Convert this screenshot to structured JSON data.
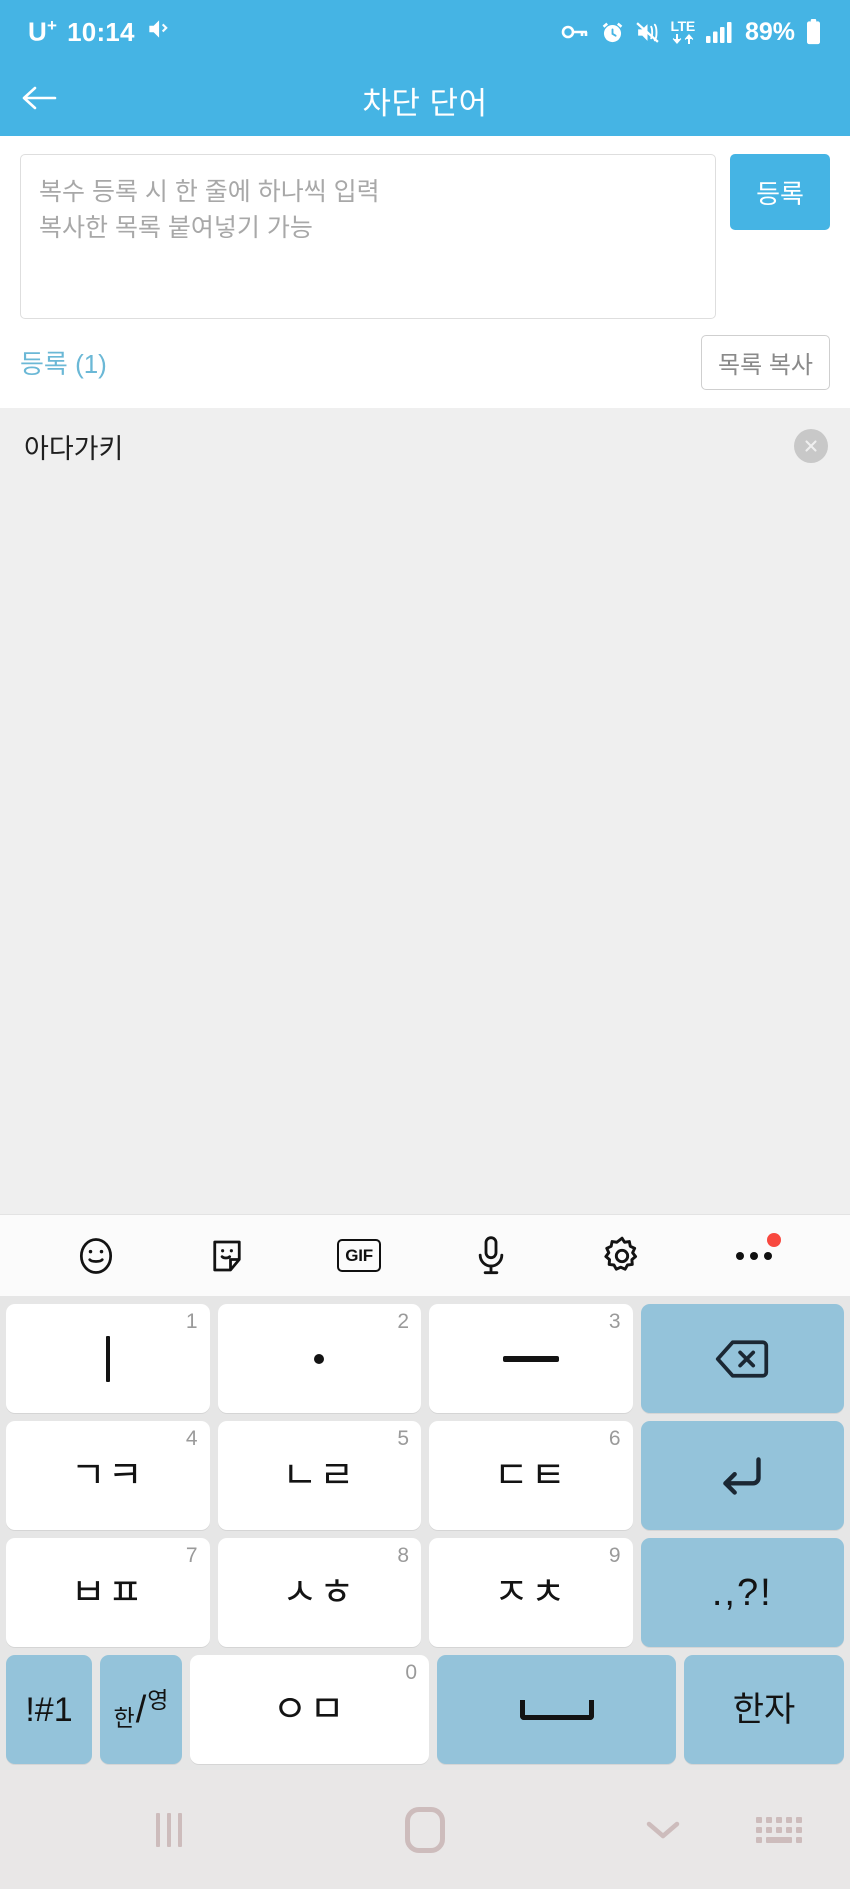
{
  "statusbar": {
    "carrier": "U",
    "carrier_sup": "+",
    "time": "10:14",
    "mute_icon": "mute-vibrate-icon",
    "vpn_key_icon": "vpn-key-icon",
    "alarm_icon": "alarm-icon",
    "sound_off_icon": "sound-off-icon",
    "network_type": "LTE",
    "signal_icon": "signal-bars-icon",
    "battery_percent": "89%",
    "battery_icon": "battery-icon"
  },
  "appbar": {
    "back_icon": "back-arrow-icon",
    "title": "차단 단어"
  },
  "compose": {
    "placeholder": "복수 등록 시 한 줄에 하나씩 입력\n복사한 목록 붙여넣기 가능",
    "value": "",
    "register_label": "등록"
  },
  "list_header": {
    "count_label": "등록 (1)",
    "copy_label": "목록 복사"
  },
  "list": {
    "items": [
      {
        "text": "아다가키",
        "delete_icon": "close-circle-icon"
      }
    ]
  },
  "keyboard_toolbar": {
    "items": [
      {
        "name": "emoji-icon",
        "label": "이모티콘"
      },
      {
        "name": "sticker-icon",
        "label": "스티커"
      },
      {
        "name": "gif-icon",
        "label": "GIF"
      },
      {
        "name": "microphone-icon",
        "label": "음성 입력"
      },
      {
        "name": "gear-icon",
        "label": "설정"
      },
      {
        "name": "more-options-icon",
        "label": "더보기"
      }
    ],
    "badge": true
  },
  "keyboard": {
    "rows": [
      [
        {
          "glyph": "ㅣ",
          "num": "1",
          "type": "char"
        },
        {
          "glyph": "·",
          "num": "2",
          "type": "char"
        },
        {
          "glyph": "ㅡ",
          "num": "3",
          "type": "char"
        },
        {
          "glyph": "",
          "num": "",
          "type": "fn",
          "icon": "backspace-icon"
        }
      ],
      [
        {
          "glyph": "ㄱㅋ",
          "num": "4",
          "type": "char"
        },
        {
          "glyph": "ㄴㄹ",
          "num": "5",
          "type": "char"
        },
        {
          "glyph": "ㄷㅌ",
          "num": "6",
          "type": "char"
        },
        {
          "glyph": "",
          "num": "",
          "type": "fn",
          "icon": "enter-icon"
        }
      ],
      [
        {
          "glyph": "ㅂㅍ",
          "num": "7",
          "type": "char"
        },
        {
          "glyph": "ㅅㅎ",
          "num": "8",
          "type": "char"
        },
        {
          "glyph": "ㅈㅊ",
          "num": "9",
          "type": "char"
        },
        {
          "glyph": ".,?!",
          "num": "",
          "type": "fn"
        }
      ],
      [
        {
          "glyph": "!#1",
          "num": "",
          "type": "fn"
        },
        {
          "glyph": "한/영",
          "num": "",
          "type": "fn",
          "icon": "lang-toggle-icon"
        },
        {
          "glyph": "ㅇㅁ",
          "num": "0",
          "type": "char"
        },
        {
          "glyph": "",
          "num": "",
          "type": "fn",
          "icon": "space-icon"
        },
        {
          "glyph": "한자",
          "num": "",
          "type": "fn"
        }
      ]
    ]
  },
  "navbar": {
    "recents_icon": "recents-icon",
    "home_icon": "home-icon",
    "hide_keyboard_icon": "chevron-down-icon",
    "keyboard_switch_icon": "keyboard-switch-icon"
  },
  "colors": {
    "accent": "#45b4e4",
    "key_fn": "#94c3da",
    "keyboard_bg": "#e6e6e6",
    "list_bg": "#efefef",
    "nav_bg": "#e9e7e7",
    "badge": "#f8483f"
  }
}
